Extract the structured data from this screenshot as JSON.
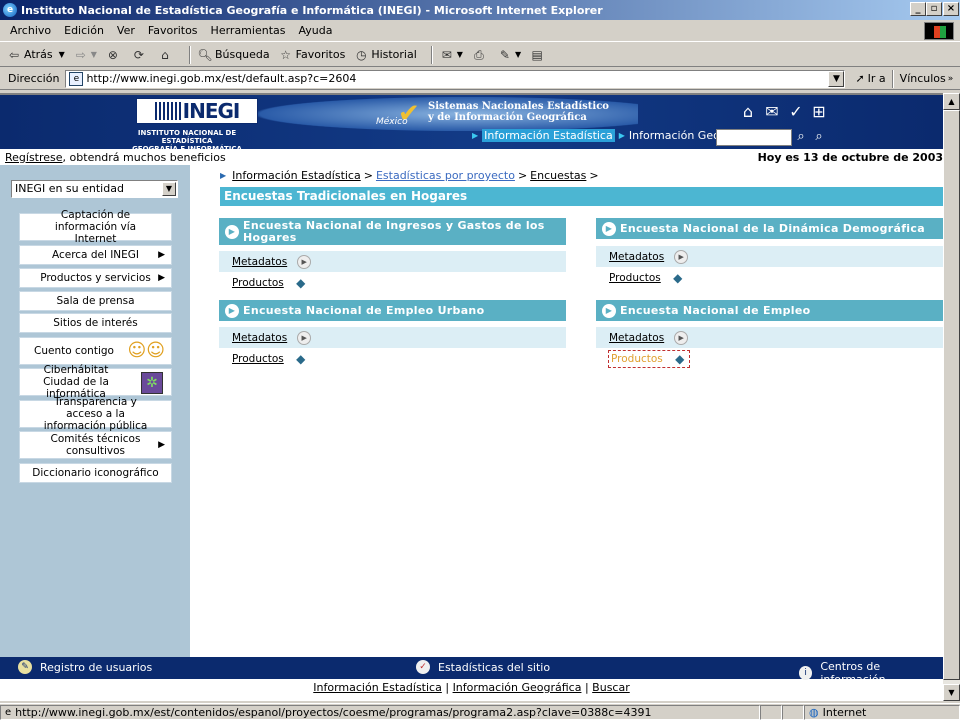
{
  "window": {
    "title": "Instituto Nacional de Estadística Geografía e Informática (INEGI) - Microsoft Internet Explorer"
  },
  "menu": [
    "Archivo",
    "Edición",
    "Ver",
    "Favoritos",
    "Herramientas",
    "Ayuda"
  ],
  "toolbar": {
    "back": "Atrás",
    "search": "Búsqueda",
    "favorites": "Favoritos",
    "history": "Historial"
  },
  "address": {
    "label": "Dirección",
    "url": "http://www.inegi.gob.mx/est/default.asp?c=2604",
    "go": "Ir a",
    "links": "Vínculos"
  },
  "header": {
    "logo": "INEGI",
    "subtitle_line1": "INSTITUTO NACIONAL DE ESTADÍSTICA",
    "subtitle_line2": "GEOGRAFÍA E INFORMÁTICA",
    "sistemas_line1": "Sistemas Nacionales Estadístico",
    "sistemas_line2": "y de Información Geográfica",
    "mexico": "México",
    "nav_active": "Información Estadística",
    "nav_other": "Información Geográfica"
  },
  "greeting": {
    "register_link": "Regístrese",
    "register_rest": ", obtendrá muchos beneficios",
    "date": "Hoy es 13 de octubre de 2003"
  },
  "sidebar": {
    "entity_select": "INEGI en su entidad",
    "items": [
      {
        "label": "Captación de información vía Internet",
        "arrow": ""
      },
      {
        "label": "Acerca del INEGI",
        "arrow": "▶"
      },
      {
        "label": "Productos y servicios",
        "arrow": "▶"
      },
      {
        "label": "Sala de prensa",
        "arrow": ""
      },
      {
        "label": "Sitios de interés",
        "arrow": ""
      },
      {
        "label": "Cuento contigo",
        "arrow": ""
      },
      {
        "label": "Ciberhábitat Ciudad de la informática",
        "arrow": ""
      },
      {
        "label": "Transparencia y acceso a la información pública",
        "arrow": ""
      },
      {
        "label": "Comités técnicos consultivos",
        "arrow": "▶"
      },
      {
        "label": "Diccionario iconográfico",
        "arrow": ""
      }
    ]
  },
  "breadcrumb": {
    "item1": "Información Estadística",
    "sep": ">",
    "item2": "Estadísticas por proyecto",
    "item3": "Encuestas"
  },
  "section_title": "Encuestas Tradicionales en Hogares",
  "panels": [
    {
      "title": "Encuesta Nacional de Ingresos y Gastos de los Hogares",
      "metadatos": "Metadatos",
      "productos": "Productos"
    },
    {
      "title": "Encuesta Nacional de la Dinámica Demográfica",
      "metadatos": "Metadatos",
      "productos": "Productos"
    },
    {
      "title": "Encuesta Nacional de Empleo Urbano",
      "metadatos": "Metadatos",
      "productos": "Productos"
    },
    {
      "title": "Encuesta Nacional de Empleo",
      "metadatos": "Metadatos",
      "productos": "Productos"
    }
  ],
  "bottom_bar": {
    "registro": "Registro de usuarios",
    "estadisticas": "Estadísticas del sitio",
    "centros": "Centros de información"
  },
  "bottom_links": {
    "link1": "Información Estadística",
    "link2": "Información Geográfica",
    "link3": "Buscar",
    "sep": "|"
  },
  "status": {
    "url": "http://www.inegi.gob.mx/est/contenidos/espanol/proyectos/coesme/programas/programa2.asp?clave=0388c=4391",
    "zone": "Internet"
  },
  "colors": {
    "header_blue": "#0b2a6e",
    "section_teal": "#4cb6d2",
    "panel_teal": "#5ab0c4",
    "sidebar_blue": "#aec6d6",
    "row_light": "#dceef5"
  }
}
